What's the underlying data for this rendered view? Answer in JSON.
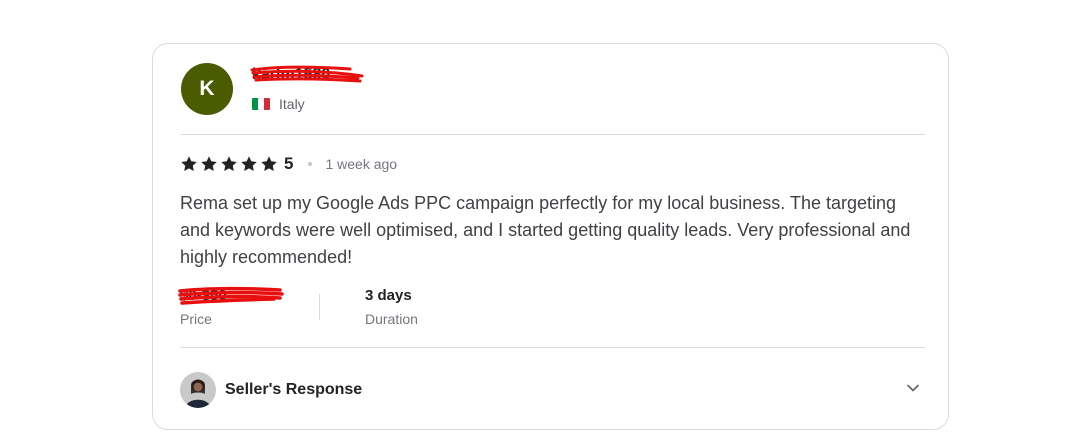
{
  "review": {
    "avatar_letter": "K",
    "avatar_color": "#4a5b00",
    "username": "karlm1580",
    "country": "Italy",
    "country_flag": "italy-flag-icon",
    "rating_value": "5",
    "stars_filled": 5,
    "stars_total": 5,
    "time_ago": "1 week ago",
    "text": "Rema set up my Google Ads PPC campaign perfectly for my local business. The targeting and keywords were well optimised, and I started getting quality leads. Very professional and highly recommended!",
    "price_value": "$0-$50",
    "price_label": "Price",
    "duration_value": "3 days",
    "duration_label": "Duration",
    "seller_response_title": "Seller's Response"
  },
  "colors": {
    "redaction": "#e8100f",
    "star": "#222325",
    "text": "#404145",
    "muted": "#74767e",
    "border": "#dadbdd"
  }
}
